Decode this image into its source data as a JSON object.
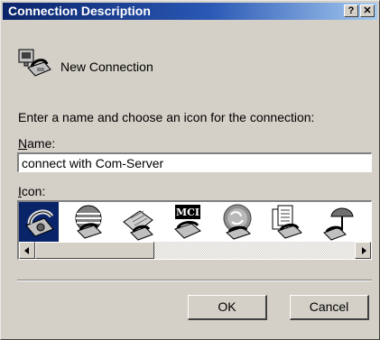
{
  "window": {
    "title": "Connection Description",
    "help_glyph": "?",
    "close_glyph": "✕"
  },
  "header": {
    "connection_name": "New Connection",
    "icon": "phone-computer-icon"
  },
  "instruction": "Enter a name and choose an icon for the connection:",
  "name_field": {
    "label_mnemonic": "N",
    "label_rest": "ame:",
    "value": "connect with Com-Server"
  },
  "icon_list": {
    "label_mnemonic": "I",
    "label_rest": "con:",
    "icons": [
      "phone-icon",
      "globe-phone-icon",
      "fax-phone-icon",
      "mci-phone-icon",
      "ge-phone-icon",
      "document-phone-icon",
      "umbrella-phone-icon"
    ],
    "selected_index": 0
  },
  "buttons": {
    "ok": "OK",
    "cancel": "Cancel"
  },
  "colors": {
    "titlebar_start": "#0a246a",
    "titlebar_end": "#a6caf0",
    "face": "#d4d0c8",
    "selection": "#0a246a"
  }
}
